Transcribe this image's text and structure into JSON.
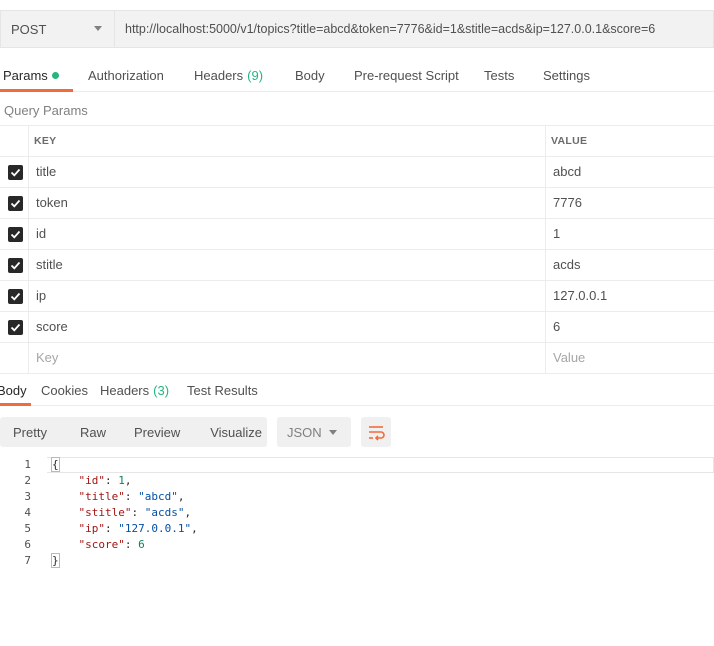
{
  "request": {
    "method": "POST",
    "url": "http://localhost:5000/v1/topics?title=abcd&token=7776&id=1&stitle=acds&ip=127.0.0.1&score=6"
  },
  "request_tabs": [
    {
      "label": "Params"
    },
    {
      "label": "Authorization"
    },
    {
      "label": "Headers",
      "count": "(9)"
    },
    {
      "label": "Body"
    },
    {
      "label": "Pre-request Script"
    },
    {
      "label": "Tests"
    },
    {
      "label": "Settings"
    }
  ],
  "query_params": {
    "title": "Query Params",
    "key_header": "KEY",
    "value_header": "VALUE",
    "rows": [
      {
        "key": "title",
        "value": "abcd"
      },
      {
        "key": "token",
        "value": "7776"
      },
      {
        "key": "id",
        "value": "1"
      },
      {
        "key": "stitle",
        "value": "acds"
      },
      {
        "key": "ip",
        "value": "127.0.0.1"
      },
      {
        "key": "score",
        "value": "6"
      }
    ],
    "key_placeholder": "Key",
    "value_placeholder": "Value"
  },
  "response_tabs": [
    {
      "label": "Body"
    },
    {
      "label": "Cookies"
    },
    {
      "label": "Headers",
      "count": "(3)"
    },
    {
      "label": "Test Results"
    }
  ],
  "view_modes": [
    "Pretty",
    "Raw",
    "Preview",
    "Visualize"
  ],
  "format": "JSON",
  "code": {
    "line_numbers": [
      "1",
      "2",
      "3",
      "4",
      "5",
      "6",
      "7"
    ],
    "open_brace": "{",
    "close_brace": "}",
    "fields": [
      {
        "key": "\"id\"",
        "value": "1",
        "type": "number"
      },
      {
        "key": "\"title\"",
        "value": "\"abcd\"",
        "type": "string"
      },
      {
        "key": "\"stitle\"",
        "value": "\"acds\"",
        "type": "string"
      },
      {
        "key": "\"ip\"",
        "value": "\"127.0.0.1\"",
        "type": "string"
      },
      {
        "key": "\"score\"",
        "value": "6",
        "type": "number"
      }
    ]
  },
  "colors": {
    "accent": "#f26b3a",
    "count": "#26b47f",
    "json_key": "#a31515",
    "json_string": "#0451a5",
    "json_number": "#098658"
  }
}
